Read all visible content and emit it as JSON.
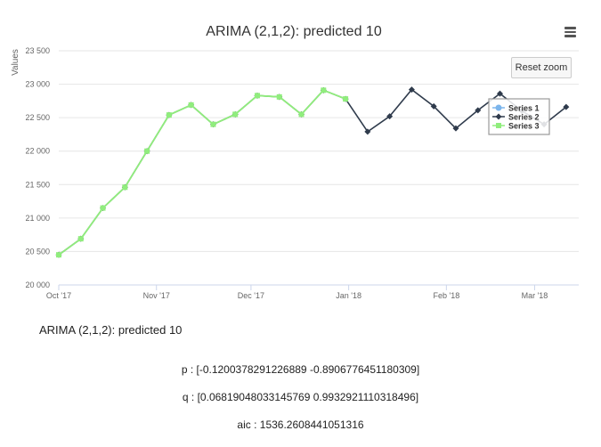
{
  "report": {
    "title": "ARIMA (2,1,2): predicted 10",
    "p_text": "p : [-0.1200378291226889 -0.8906776451180309]",
    "q_text": "q : [0.06819048033145769 0.9932921110318496]",
    "aic_text": "aic : 1536.2608441051316"
  },
  "controls": {
    "reset_zoom_label": "Reset zoom",
    "menu_icon": "hamburger-menu-icon"
  },
  "chart_data": {
    "type": "line",
    "title": "ARIMA (2,1,2): predicted 10",
    "ylabel": "Values",
    "xlabel": "",
    "ylim": [
      20000,
      23500
    ],
    "xlim": [
      "2017-10-01",
      "2018-03-15"
    ],
    "y_ticks": [
      20000,
      20500,
      21000,
      21500,
      22000,
      22500,
      23000,
      23500
    ],
    "y_tick_labels": [
      "20 000",
      "20 500",
      "21 000",
      "21 500",
      "22 000",
      "22 500",
      "23 000",
      "23 500"
    ],
    "x_ticks": [
      "2017-10-01",
      "2017-11-01",
      "2017-12-01",
      "2018-01-01",
      "2018-02-01",
      "2018-03-01"
    ],
    "x_tick_labels": [
      "Oct '17",
      "Nov '17",
      "Dec '17",
      "Jan '18",
      "Feb '18",
      "Mar '18"
    ],
    "grid": true,
    "legend_position": "right",
    "series": [
      {
        "name": "Series 1",
        "color": "#7cb5ec",
        "marker": "circle",
        "x": [],
        "y": []
      },
      {
        "name": "Series 2",
        "color": "#2f3b4c",
        "marker": "diamond",
        "x": [
          "2017-10-01",
          "2017-10-08",
          "2017-10-15",
          "2017-10-22",
          "2017-10-29",
          "2017-11-05",
          "2017-11-12",
          "2017-11-19",
          "2017-11-26",
          "2017-12-03",
          "2017-12-10",
          "2017-12-17",
          "2017-12-24",
          "2017-12-31",
          "2018-01-07",
          "2018-01-14",
          "2018-01-21",
          "2018-01-28",
          "2018-02-04",
          "2018-02-11",
          "2018-02-18",
          "2018-02-25",
          "2018-03-04",
          "2018-03-11"
        ],
        "y": [
          20450,
          20690,
          21150,
          21460,
          22000,
          22540,
          22690,
          22400,
          22550,
          22830,
          22810,
          22550,
          22910,
          22780,
          22290,
          22520,
          22920,
          22670,
          22340,
          22610,
          22860,
          22600,
          22400,
          22660
        ]
      },
      {
        "name": "Series 3",
        "color": "#90ed7d",
        "marker": "square",
        "x": [
          "2017-10-01",
          "2017-10-08",
          "2017-10-15",
          "2017-10-22",
          "2017-10-29",
          "2017-11-05",
          "2017-11-12",
          "2017-11-19",
          "2017-11-26",
          "2017-12-03",
          "2017-12-10",
          "2017-12-17",
          "2017-12-24",
          "2017-12-31"
        ],
        "y": [
          20450,
          20690,
          21150,
          21460,
          22000,
          22540,
          22690,
          22400,
          22550,
          22830,
          22810,
          22550,
          22910,
          22780
        ]
      }
    ]
  }
}
